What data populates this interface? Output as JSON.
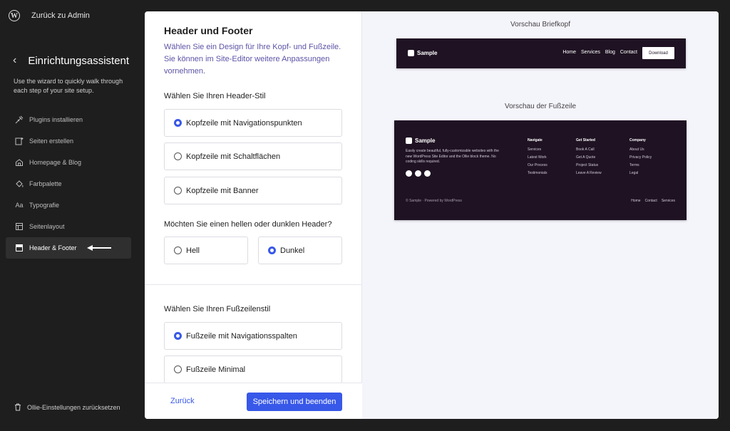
{
  "sidebar": {
    "back_to_admin": "Zurück zu Admin",
    "wizard_title": "Einrichtungsassistent",
    "wizard_desc": "Use the wizard to quickly walk through each step of your site setup.",
    "items": [
      {
        "label": "Plugins installieren",
        "icon": "plug-icon"
      },
      {
        "label": "Seiten erstellen",
        "icon": "add-page-icon"
      },
      {
        "label": "Homepage & Blog",
        "icon": "home-icon"
      },
      {
        "label": "Farbpalette",
        "icon": "paint-bucket-icon"
      },
      {
        "label": "Typografie",
        "icon": "typography-icon"
      },
      {
        "label": "Seitenlayout",
        "icon": "layout-icon"
      },
      {
        "label": "Header & Footer",
        "icon": "header-footer-icon",
        "active": true
      }
    ],
    "reset_label": "Ollie-Einstellungen zurücksetzen"
  },
  "form": {
    "title": "Header und Footer",
    "description": "Wählen Sie ein Design für Ihre Kopf- und Fußzeile. Sie können im Site-Editor weitere Anpassungen vornehmen.",
    "header_style_question": "Wählen Sie Ihren Header-Stil",
    "header_style_options": [
      "Kopfzeile mit Navigationspunkten",
      "Kopfzeile mit Schaltflächen",
      "Kopfzeile mit Banner"
    ],
    "header_style_selected": "Kopfzeile mit Navigationspunkten",
    "theme_question": "Möchten Sie einen hellen oder dunklen Header?",
    "theme_options": [
      "Hell",
      "Dunkel"
    ],
    "theme_selected": "Dunkel",
    "footer_style_question": "Wählen Sie Ihren Fußzeilenstil",
    "footer_style_options": [
      "Fußzeile mit Navigationsspalten",
      "Fußzeile Minimal"
    ],
    "footer_style_selected": "Fußzeile mit Navigationsspalten",
    "back_label": "Zurück",
    "save_label": "Speichern und beenden"
  },
  "preview": {
    "header_title": "Vorschau Briefkopf",
    "footer_title": "Vorschau der Fußzeile",
    "brand": "Sample",
    "header_nav": [
      "Home",
      "Services",
      "Blog",
      "Contact"
    ],
    "header_button": "Download",
    "footer_blurb": "Easily create beautiful, fully-customizable websites with the new WordPress Site Editor and the Ollie block theme. No coding skills required.",
    "footer_columns": [
      {
        "heading": "Navigate",
        "links": [
          "Services",
          "Latest Work",
          "Our Process",
          "Testimonials"
        ]
      },
      {
        "heading": "Get Started",
        "links": [
          "Book A Call",
          "Get A Quote",
          "Project Status",
          "Leave A Review"
        ]
      },
      {
        "heading": "Company",
        "links": [
          "About Us",
          "Privacy Policy",
          "Terms",
          "Legal"
        ]
      }
    ],
    "footer_copyright": "© Sample · Powered by WordPress",
    "footer_links": [
      "Home",
      "Contact",
      "Services"
    ]
  },
  "colors": {
    "accent": "#3858e9",
    "sidebar_bg": "#1e1e1e",
    "mock_dark": "#1f1323"
  }
}
